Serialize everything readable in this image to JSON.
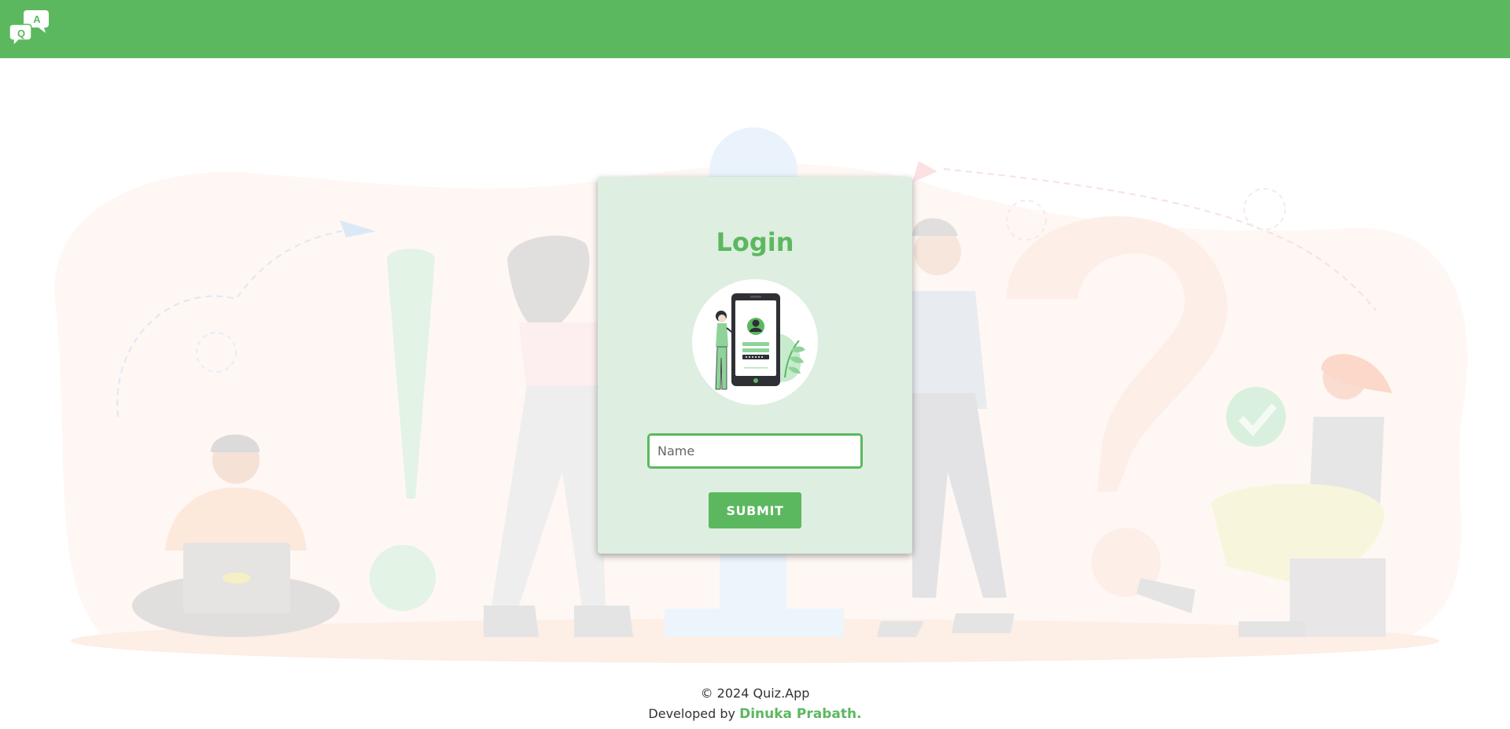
{
  "header": {
    "logo_letters": {
      "a": "A",
      "q": "Q"
    },
    "color": "#5cb85f"
  },
  "login": {
    "title": "Login",
    "name_placeholder": "Name",
    "name_value": "",
    "submit_label": "SUBMIT",
    "illustration": "phone-login-illustration"
  },
  "footer": {
    "copyright": "© 2024 Quiz.App",
    "developed_by": "Developed by",
    "author": "Dinuka Prabath."
  },
  "background_illustration": "faded-people-question-exclamation-marks"
}
